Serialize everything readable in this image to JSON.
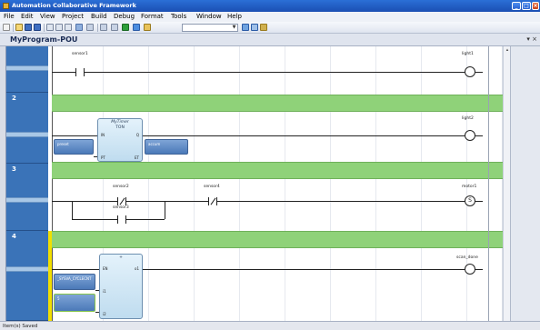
{
  "window": {
    "title": "Automation Collaborative Framework",
    "minimize": "_",
    "maximize": "□",
    "close": "×"
  },
  "menu": [
    "File",
    "Edit",
    "View",
    "Project",
    "Build",
    "Debug",
    "Format",
    "Tools",
    "Window",
    "Help"
  ],
  "document": {
    "title": "MyProgram-POU",
    "controls": "▾ ×"
  },
  "rungs": [
    {
      "number": "",
      "contact": "sensor1",
      "coil": "light1"
    },
    {
      "number": "2",
      "block_instance": "MyTimer",
      "block_type": "TON",
      "pins": {
        "in": "IN",
        "q": "Q",
        "pt": "PT",
        "et": "ET"
      },
      "input_var": "preset",
      "output_var": "accum",
      "coil": "light2"
    },
    {
      "number": "3",
      "contact_a": "sensor2",
      "contact_b": "sensor4",
      "contact_parallel": "sensor3",
      "coil": "motor1",
      "coil_symbol": "S"
    },
    {
      "number": "4",
      "block_instance": "+",
      "pins": {
        "en": "EN",
        "o1": "o1",
        "i1": "i1",
        "i2": "i2"
      },
      "input_var_1": "_SYSVA_CYCLECNT",
      "input_var_2": "5",
      "coil": "scan_done"
    }
  ],
  "status": "Item(s) Saved"
}
